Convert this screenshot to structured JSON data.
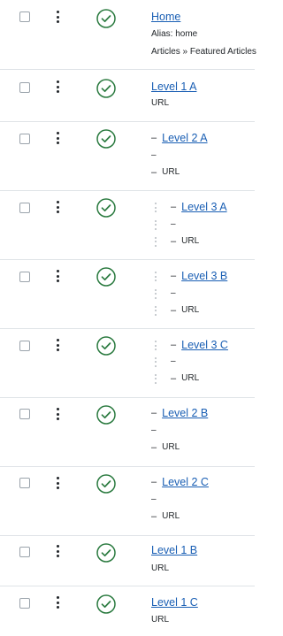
{
  "rows": [
    {
      "title": "Home",
      "line2": "Alias: home",
      "line3": "Articles » Featured Articles"
    },
    {
      "title": "Level 1 A",
      "line2": "URL"
    },
    {
      "title": "Level 2 A",
      "dash": "–",
      "line2": "–",
      "line3": "URL"
    },
    {
      "title": "Level 3 A",
      "dash": "–",
      "line2": "–",
      "line3": "URL"
    },
    {
      "title": "Level 3 B",
      "dash": "–",
      "line2": "–",
      "line3": "URL"
    },
    {
      "title": "Level 3 C",
      "dash": "–",
      "line2": "–",
      "line3": "URL"
    },
    {
      "title": "Level 2 B",
      "dash": "–",
      "line2": "–",
      "line3": "URL"
    },
    {
      "title": "Level 2 C",
      "dash": "–",
      "line2": "–",
      "line3": "URL"
    },
    {
      "title": "Level 1 B",
      "line2": "URL"
    },
    {
      "title": "Level 1 C",
      "line2": "URL"
    }
  ],
  "icons": {
    "status": "published-check-icon",
    "actions": "more-vertical-icon"
  },
  "colors": {
    "link": "#1a5fb4",
    "status": "#2a7a3f",
    "divider": "#dfe3e7"
  }
}
